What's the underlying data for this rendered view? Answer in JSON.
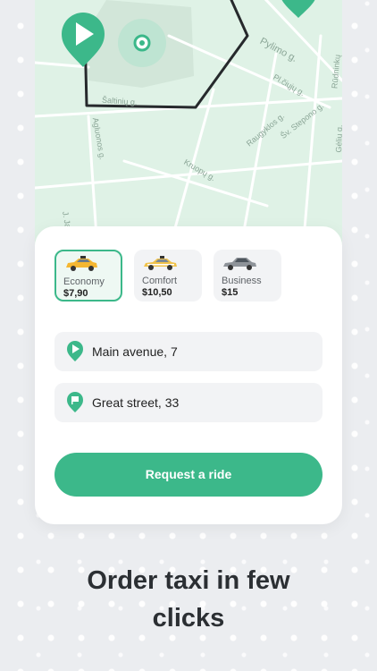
{
  "map": {
    "street_labels": [
      "Pylimo g.",
      "Pylimo g.",
      "Pl.čiųjų g.",
      "Raugyklos g.",
      "Šv. Stepono g.",
      "Rūdninkų",
      "Gėlių g.",
      "Kruopų g.",
      "Agluonos g.",
      "J. Jab",
      "Šaltinių g."
    ]
  },
  "ride_classes": [
    {
      "name": "Economy",
      "price": "$7,90",
      "selected": true
    },
    {
      "name": "Comfort",
      "price": "$10,50",
      "selected": false
    },
    {
      "name": "Business",
      "price": "$15",
      "selected": false
    }
  ],
  "route": {
    "pickup": "Main avenue, 7",
    "destination": "Great street, 33"
  },
  "request_button": "Request a ride",
  "headline": "Order taxi in few clicks",
  "colors": {
    "accent": "#3cb88a",
    "background": "#ebedf0",
    "map": "#dff2e6"
  }
}
